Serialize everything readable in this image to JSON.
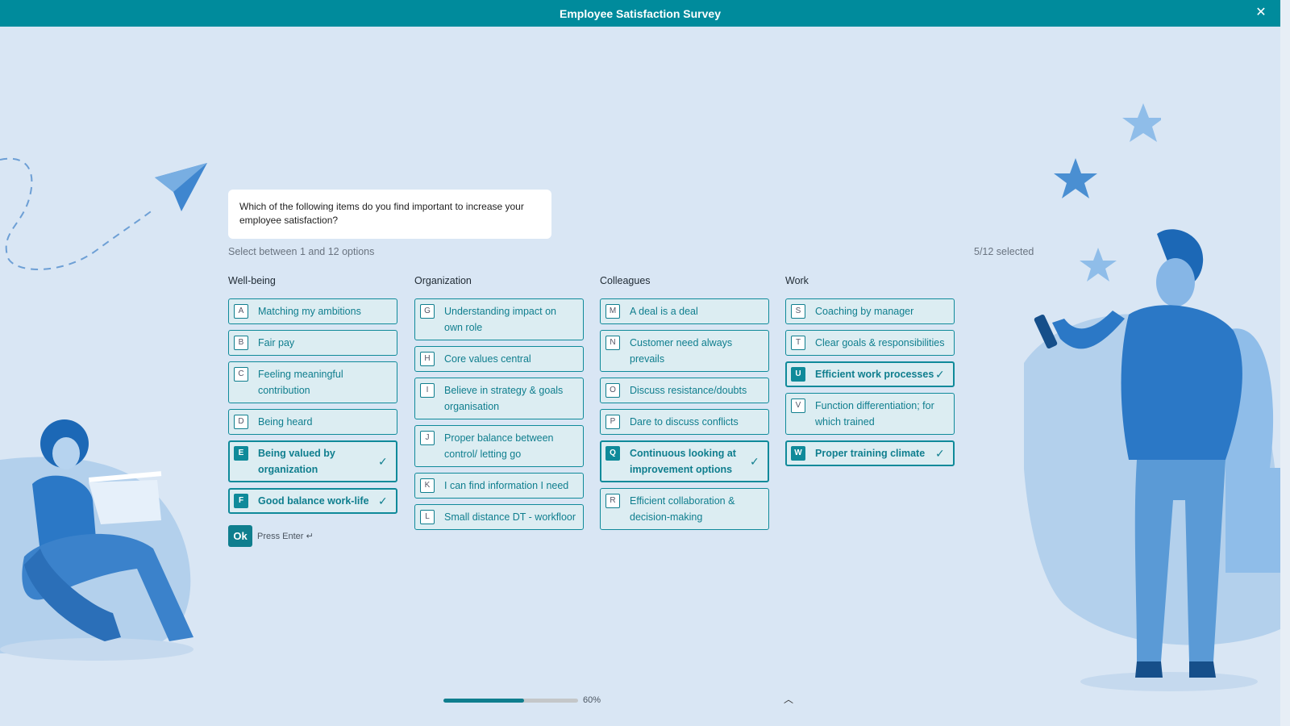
{
  "header": {
    "title": "Employee Satisfaction Survey",
    "close_icon": "close-icon"
  },
  "question": {
    "text": "Which of the following items do you find important to increase your employee satisfaction?",
    "hint": "Select between 1 and 12 options",
    "selected_count": "5/12 selected"
  },
  "columns": [
    {
      "title": "Well-being",
      "options": [
        {
          "key": "A",
          "label": "Matching my ambitions"
        },
        {
          "key": "B",
          "label": "Fair pay"
        },
        {
          "key": "C",
          "label": "Feeling meaningful contribution"
        },
        {
          "key": "D",
          "label": "Being heard"
        },
        {
          "key": "E",
          "label": "Being valued by organization",
          "selected": true
        },
        {
          "key": "F",
          "label": "Good balance work-life",
          "selected": true
        }
      ]
    },
    {
      "title": "Organization",
      "options": [
        {
          "key": "G",
          "label": "Understanding impact on own role"
        },
        {
          "key": "H",
          "label": "Core values central"
        },
        {
          "key": "I",
          "label": "Believe in strategy & goals organisation"
        },
        {
          "key": "J",
          "label": "Proper balance between control/ letting go"
        },
        {
          "key": "K",
          "label": "I can find information I need"
        },
        {
          "key": "L",
          "label": "Small distance DT - workfloor"
        }
      ]
    },
    {
      "title": "Colleagues",
      "options": [
        {
          "key": "M",
          "label": "A deal is a deal"
        },
        {
          "key": "N",
          "label": "Customer need always prevails"
        },
        {
          "key": "O",
          "label": "Discuss resistance/doubts"
        },
        {
          "key": "P",
          "label": "Dare to discuss conflicts"
        },
        {
          "key": "Q",
          "label": "Continuous looking at improvement options",
          "selected": true
        },
        {
          "key": "R",
          "label": "Efficient collaboration & decision-making"
        }
      ]
    },
    {
      "title": "Work",
      "options": [
        {
          "key": "S",
          "label": "Coaching by manager"
        },
        {
          "key": "T",
          "label": "Clear goals & responsibilities"
        },
        {
          "key": "U",
          "label": "Efficient work processes",
          "selected": true
        },
        {
          "key": "V",
          "label": "Function differentiation; for which trained"
        },
        {
          "key": "W",
          "label": "Proper training climate",
          "selected": true
        }
      ]
    }
  ],
  "footer": {
    "ok_label": "Ok",
    "press_enter": "Press Enter ↵",
    "progress_value": 0.6,
    "progress_label": "60%",
    "nav_up_icon": "chevron-up-icon"
  },
  "colors": {
    "accent": "#0f8a9a",
    "header": "#008b9c",
    "background": "#d9e6f4"
  }
}
